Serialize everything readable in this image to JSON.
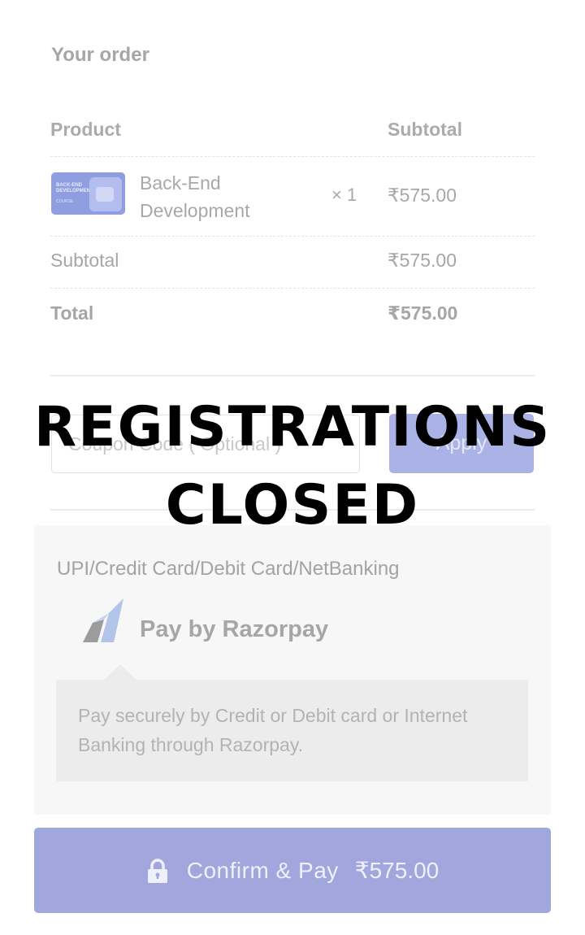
{
  "order": {
    "title": "Your order",
    "columns": {
      "product": "Product",
      "subtotal": "Subtotal"
    },
    "item": {
      "name": "Back-End Development",
      "thumb_line1": "BACK-END",
      "thumb_line2": "DEVELOPMENT",
      "thumb_tag": "COURSE",
      "quantity": "× 1",
      "price": "₹575.00"
    },
    "subtotal_label": "Subtotal",
    "subtotal_value": "₹575.00",
    "total_label": "Total",
    "total_value": "₹575.00"
  },
  "coupon": {
    "placeholder": "Coupon Code ( Optional )",
    "apply_label": "Apply"
  },
  "payment": {
    "method": "UPI/Credit Card/Debit Card/NetBanking",
    "provider": "Pay by Razorpay",
    "description": "Pay securely by Credit or Debit card or Internet Banking through Razorpay."
  },
  "confirm": {
    "label": "Confirm & Pay",
    "amount": "₹575.00"
  },
  "overlay": {
    "line1": "REGISTRATIONS",
    "line2": "CLOSED"
  },
  "icons": {
    "lock": "lock-icon",
    "razorpay": "razorpay-logo"
  },
  "colors": {
    "accent": "#a1a7dc",
    "apply": "#aab2e6",
    "overlay_text": "#000000"
  }
}
